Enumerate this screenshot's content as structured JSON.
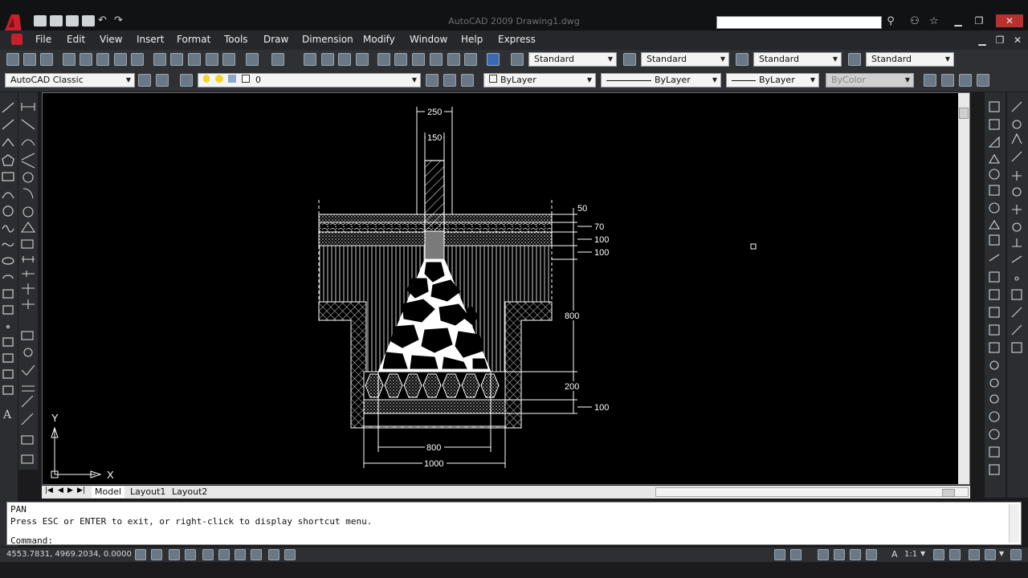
{
  "title": "AutoCAD 2009 Drawing1.dwg",
  "menu": [
    "File",
    "Edit",
    "View",
    "Insert",
    "Format",
    "Tools",
    "Draw",
    "Dimension",
    "Modify",
    "Window",
    "Help",
    "Express"
  ],
  "styles": {
    "text_style": "Standard",
    "dim_style": "Standard",
    "table_style": "Standard",
    "mleader_style": "Standard"
  },
  "workspace": "AutoCAD Classic",
  "layer": "0",
  "properties": {
    "color": "ByLayer",
    "linetype": "ByLayer",
    "lineweight": "ByLayer",
    "plotstyle": "ByColor"
  },
  "tabs": {
    "model": "Model",
    "layout1": "Layout1",
    "layout2": "Layout2"
  },
  "command": {
    "line1": "PAN",
    "line2": "Press ESC or ENTER to exit, or right-click to display shortcut menu.",
    "prompt": "Command:"
  },
  "status": {
    "coordinates": "4553.7831, 4969.2034, 0.0000",
    "scale": "1:1"
  },
  "ucs": {
    "x": "X",
    "y": "Y"
  },
  "dimensions": {
    "d250": "250",
    "d150": "150",
    "d50": "50",
    "d70": "70",
    "d100a": "100",
    "d100b": "100",
    "d800v": "800",
    "d200": "200",
    "d100c": "100",
    "d800h": "800",
    "d1000": "1000"
  },
  "colors": {
    "canvas": "#000000",
    "ui_dark": "#2e3033",
    "accent": "#d6202a"
  }
}
